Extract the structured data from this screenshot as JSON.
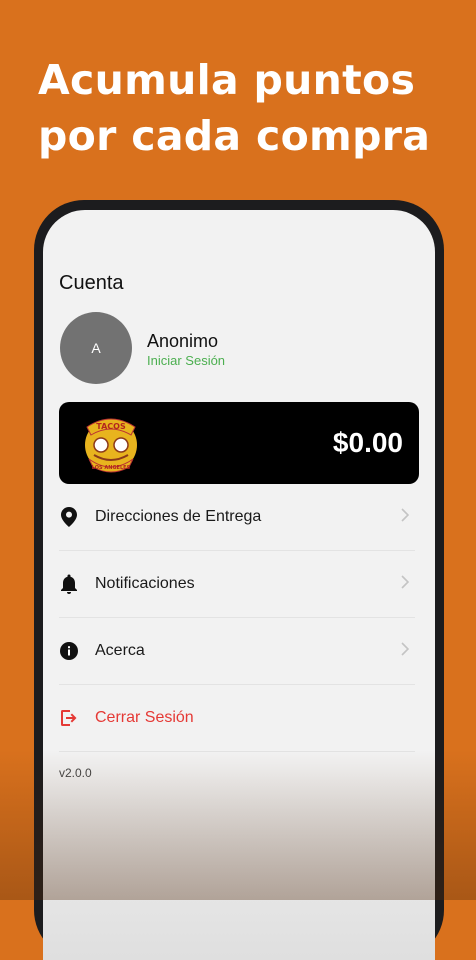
{
  "headline": {
    "line1": "Acumula puntos",
    "line2": "por cada compra"
  },
  "account": {
    "title": "Cuenta",
    "avatar_initial": "A",
    "user_name": "Anonimo",
    "login_link": "Iniciar Sesión"
  },
  "points_card": {
    "value": "$0.00",
    "logo_text_top": "TACOS",
    "logo_text_bottom": "LOS ANGELES"
  },
  "menu": {
    "items": [
      {
        "label": "Direcciones de Entrega",
        "icon": "location-pin-icon"
      },
      {
        "label": "Notificaciones",
        "icon": "bell-icon"
      },
      {
        "label": "Acerca",
        "icon": "info-icon"
      }
    ],
    "logout": {
      "label": "Cerrar Sesión",
      "icon": "logout-icon"
    }
  },
  "version": "v2.0.0",
  "colors": {
    "background": "#d9711d",
    "accent_green": "#4caf50",
    "danger_red": "#e53935",
    "card_black": "#000000"
  }
}
